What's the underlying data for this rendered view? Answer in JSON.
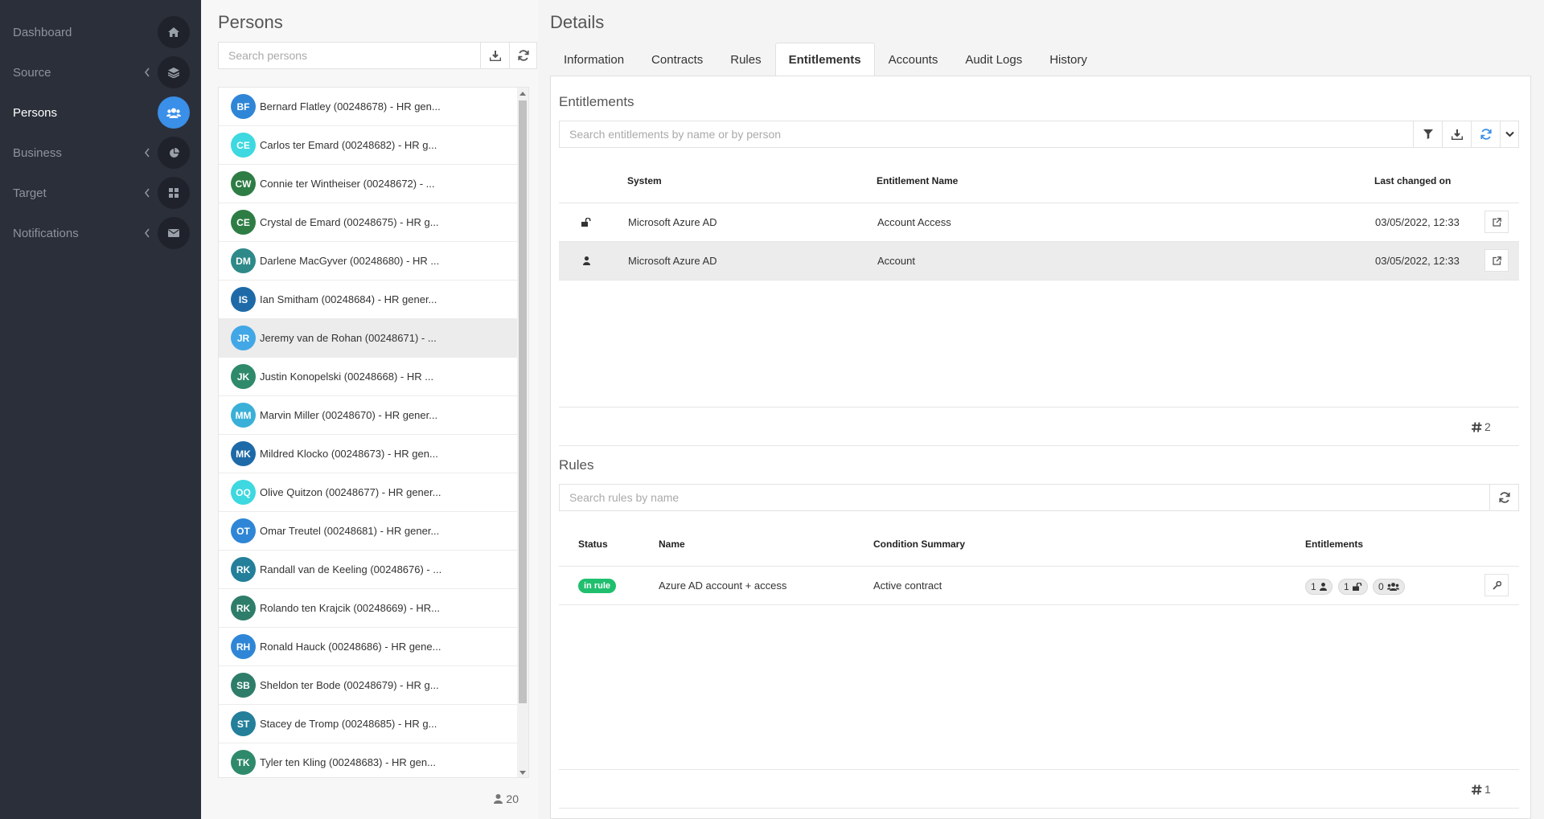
{
  "sidebar": {
    "items": [
      {
        "label": "Dashboard",
        "icon": "home-icon",
        "active": false,
        "chevron": false
      },
      {
        "label": "Source",
        "icon": "layers-icon",
        "active": false,
        "chevron": true
      },
      {
        "label": "Persons",
        "icon": "users-icon",
        "active": true,
        "chevron": false
      },
      {
        "label": "Business",
        "icon": "pie-chart-icon",
        "active": false,
        "chevron": true
      },
      {
        "label": "Target",
        "icon": "grid-icon",
        "active": false,
        "chevron": true
      },
      {
        "label": "Notifications",
        "icon": "envelope-icon",
        "active": false,
        "chevron": true
      }
    ]
  },
  "persons": {
    "title": "Persons",
    "search_placeholder": "Search persons",
    "count": "20",
    "items": [
      {
        "initials": "BF",
        "name": "Bernard Flatley (00248678) - HR gen...",
        "color": "#2f86d6"
      },
      {
        "initials": "CE",
        "name": "Carlos ter Emard (00248682) - HR g...",
        "color": "#3dd8e0"
      },
      {
        "initials": "CW",
        "name": "Connie ter Wintheiser (00248672) - ...",
        "color": "#2e7d45"
      },
      {
        "initials": "CE",
        "name": "Crystal de Emard (00248675) - HR g...",
        "color": "#2e7d45"
      },
      {
        "initials": "DM",
        "name": "Darlene MacGyver (00248680) - HR ...",
        "color": "#2e8a88"
      },
      {
        "initials": "IS",
        "name": "Ian Smitham (00248684) - HR gener...",
        "color": "#1e6aa8"
      },
      {
        "initials": "JR",
        "name": "Jeremy van de Rohan (00248671) - ...",
        "color": "#42a7e6",
        "selected": true
      },
      {
        "initials": "JK",
        "name": "Justin Konopelski (00248668) - HR ...",
        "color": "#2e8a6a"
      },
      {
        "initials": "MM",
        "name": "Marvin Miller (00248670) - HR gener...",
        "color": "#3ab0d8"
      },
      {
        "initials": "MK",
        "name": "Mildred Klocko (00248673) - HR gen...",
        "color": "#1e6aa8"
      },
      {
        "initials": "OQ",
        "name": "Olive Quitzon (00248677) - HR gener...",
        "color": "#3dd8e0"
      },
      {
        "initials": "OT",
        "name": "Omar Treutel (00248681) - HR gener...",
        "color": "#2f86d6"
      },
      {
        "initials": "RK",
        "name": "Randall van de Keeling (00248676) - ...",
        "color": "#237f9a"
      },
      {
        "initials": "RK",
        "name": "Rolando ten Krajcik (00248669) - HR...",
        "color": "#2e7d6a"
      },
      {
        "initials": "RH",
        "name": "Ronald Hauck (00248686) - HR gene...",
        "color": "#2f86d6"
      },
      {
        "initials": "SB",
        "name": "Sheldon ter Bode (00248679) - HR g...",
        "color": "#2e7d6a"
      },
      {
        "initials": "ST",
        "name": "Stacey de Tromp (00248685) - HR g...",
        "color": "#237f9a"
      },
      {
        "initials": "TK",
        "name": "Tyler ten Kling (00248683) - HR gen...",
        "color": "#2e8a6a"
      }
    ]
  },
  "details": {
    "title": "Details",
    "tabs": [
      {
        "label": "Information",
        "active": false
      },
      {
        "label": "Contracts",
        "active": false
      },
      {
        "label": "Rules",
        "active": false
      },
      {
        "label": "Entitlements",
        "active": true
      },
      {
        "label": "Accounts",
        "active": false
      },
      {
        "label": "Audit Logs",
        "active": false
      },
      {
        "label": "History",
        "active": false
      }
    ],
    "entitlements": {
      "title": "Entitlements",
      "search_placeholder": "Search entitlements by name or by person",
      "columns": {
        "system": "System",
        "name": "Entitlement Name",
        "changed": "Last changed on"
      },
      "rows": [
        {
          "icon": "unlock-icon",
          "system": "Microsoft Azure AD",
          "name": "Account Access",
          "changed": "03/05/2022, 12:33"
        },
        {
          "icon": "user-icon",
          "system": "Microsoft Azure AD",
          "name": "Account",
          "changed": "03/05/2022, 12:33"
        }
      ],
      "count": "2"
    },
    "rules": {
      "title": "Rules",
      "search_placeholder": "Search rules by name",
      "columns": {
        "status": "Status",
        "name": "Name",
        "condition": "Condition Summary",
        "entitlements": "Entitlements"
      },
      "rows": [
        {
          "status": "in rule",
          "name": "Azure AD account + access",
          "condition": "Active contract",
          "accounts": "1",
          "access": "1",
          "groups": "0"
        }
      ],
      "count": "1"
    }
  },
  "colors": {
    "accent": "#3a8fe8",
    "sidebar_bg": "#2b2f3a",
    "success": "#1fbf6e"
  }
}
